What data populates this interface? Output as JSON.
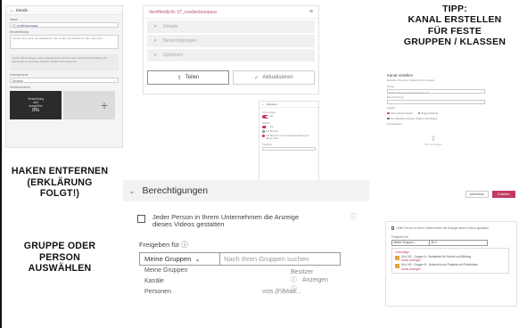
{
  "captions": {
    "tipp": [
      "TIPP:",
      "KANAL ERSTELLEN",
      "FÜR FESTE",
      "GRUPPEN / KLASSEN"
    ],
    "haken": [
      "HAKEN ENTFERNEN",
      "(ERKLÄRUNG",
      "FOLGT!)"
    ],
    "gruppe": [
      "GRUPPE ODER",
      "PERSON",
      "AUSWÄHLEN"
    ]
  },
  "details": {
    "header": "Details",
    "name_label": "Name",
    "name_value": "07_medienkompass",
    "description_label": "Beschreibung",
    "description_value": "Kennen Sie schon die Mediathek? Hier finden Sie Medien für den Unterricht.",
    "note": "Durch das Festlegen einer Videosprache wird die automatische Untertitelung für barrierefreie Sprachen aktiviert. Weitere Informationen",
    "language_label": "Videosprache",
    "language_value": "Deutsch",
    "thumbnail_label": "Miniaturansicht",
    "thumb_text": [
      "Verarbeitung",
      "wird",
      "ausgeführt"
    ],
    "thumb_pct": "0%",
    "add_symbol": "+"
  },
  "video": {
    "published": "Veröffentlicht: 07_medienkompass",
    "menu_symbol": "≡",
    "sections": [
      "Details",
      "Berechtigungen",
      "Optionen"
    ],
    "share_button": "Teilen",
    "save_button": "Aktualisieren"
  },
  "toggles": {
    "header": "Optionen",
    "comments_label": "Kommentare",
    "comments_state": "Ein",
    "notes_label": "Notizen",
    "notes_state": "Ein",
    "options": [
      "Nur Besitzer",
      "Alle Benutzer mit Anzeigeberechtigung für dieses Video"
    ],
    "subtitle_label": "Untertitel"
  },
  "perms": {
    "header": "Berechtigungen",
    "checkbox_text_1": "Jeder Person in Ihrem Unternehmen die Anzeige",
    "checkbox_text_2": "dieses Videos gestatten",
    "share_label": "Freigeben für",
    "share_select": "Meine Gruppen",
    "share_placeholder": "Nach Ihren Gruppen suchen",
    "dropdown_items": [
      "Meine Gruppen",
      "Kanäle",
      "Personen"
    ],
    "owner_label": "Besitzer",
    "viewer_label": "Anzeigen",
    "partial_text": "vcts (FilMad..."
  },
  "channel": {
    "title": "Kanal erstellen",
    "subtitle": "Erstellen Sie einen Kanal für Ihre Videos",
    "name_label": "Name",
    "name_placeholder": "Geben Sie einen Kanalnamen ein",
    "desc_label": "Beschreibung",
    "access_label": "Zugriff",
    "access_options": [
      "Unternehmensweit",
      "Eingeschränkt"
    ],
    "check_text": "Nur Besitzer können Videos hinzufügen",
    "design_label": "Kanaldesign",
    "drop_text": "Bild hochladen",
    "cancel_button": "Abbrechen",
    "create_button": "Erstellen"
  },
  "mini": {
    "checkbox_text": "Jeder Person in Ihrem Unternehmen die Anzeige dieses Videos gestatten",
    "share_label": "Freigeben für",
    "share_select": "Meine Gruppen",
    "share_value": "06 d",
    "list_header": "Vorschläge",
    "items": [
      {
        "title": "06 d HS - Gruppe A - Mediathek für Schule und Bildung",
        "link": "Kanal anzeigen"
      },
      {
        "title": "06 d HS - Gruppe B - Unterricht und Projekte mit FilmMedien",
        "link": "Kanal anzeigen"
      }
    ]
  }
}
